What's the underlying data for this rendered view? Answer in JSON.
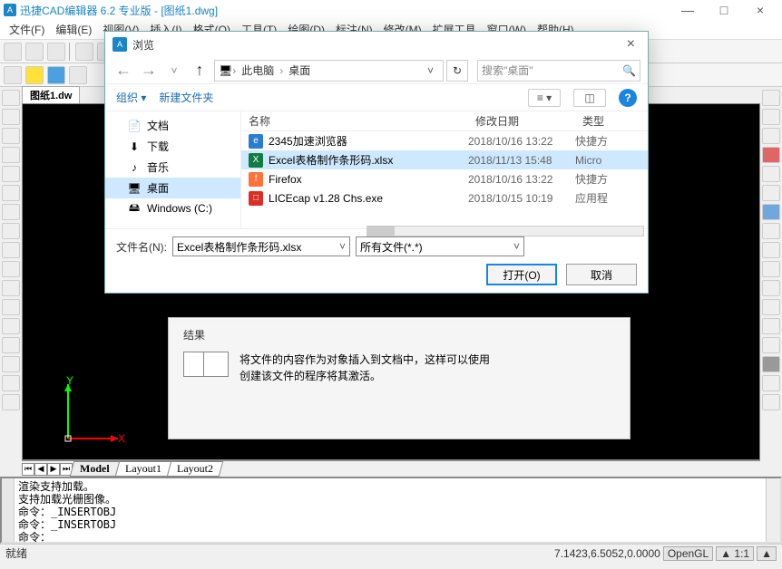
{
  "app": {
    "title": "迅捷CAD编辑器 6.2 专业版  - [图纸1.dwg]",
    "win_min": "—",
    "win_max": "□",
    "win_close": "×"
  },
  "menubar": [
    "文件(F)",
    "编辑(E)",
    "视图(V)",
    "插入(I)",
    "格式(O)",
    "工具(T)",
    "绘图(D)",
    "标注(N)",
    "修改(M)",
    "扩展工具",
    "窗口(W)",
    "帮助(H)"
  ],
  "doc_tab": "图纸1.dw",
  "layout_tabs": [
    "Model",
    "Layout1",
    "Layout2"
  ],
  "result": {
    "head": "结果",
    "body": "将文件的内容作为对象插入到文档中，这样可以使用创建该文件的程序将其激活。"
  },
  "cmd_text": "渲染支持加载。\n支持加载光栅图像。\n命令：_INSERTOBJ\n命令：_INSERTOBJ\n命令：",
  "status": {
    "left": "就绪",
    "coords": "7.1423,6.5052,0.0000",
    "gl": "OpenGL",
    "a1": "▲ 1:1",
    "a2": "▲"
  },
  "axes": {
    "x": "X",
    "y": "Y"
  },
  "dialog": {
    "title": "浏览",
    "breadcrumb": {
      "pc": "此电脑",
      "desk": "桌面"
    },
    "search_placeholder": "搜索\"桌面\"",
    "organize": "组织",
    "new_folder": "新建文件夹",
    "side": [
      {
        "icon": "📄",
        "label": "文档"
      },
      {
        "icon": "⬇",
        "label": "下载"
      },
      {
        "icon": "♪",
        "label": "音乐"
      },
      {
        "icon": "🖥",
        "label": "桌面",
        "selected": true
      },
      {
        "icon": "🖴",
        "label": "Windows (C:)"
      }
    ],
    "columns": {
      "name": "名称",
      "date": "修改日期",
      "type": "类型"
    },
    "rows": [
      {
        "icon_bg": "#2b7cd3",
        "icon_txt": "e",
        "name": "2345加速浏览器",
        "date": "2018/10/16 13:22",
        "type": "快捷方"
      },
      {
        "icon_bg": "#107c41",
        "icon_txt": "X",
        "name": "Excel表格制作条形码.xlsx",
        "date": "2018/11/13 15:48",
        "type": "Micro",
        "selected": true
      },
      {
        "icon_bg": "#ff7139",
        "icon_txt": "f",
        "name": "Firefox",
        "date": "2018/10/16 13:22",
        "type": "快捷方"
      },
      {
        "icon_bg": "#d93025",
        "icon_txt": "□",
        "name": "LICEcap v1.28 Chs.exe",
        "date": "2018/10/15 10:19",
        "type": "应用程"
      }
    ],
    "filename_label": "文件名(N):",
    "filename_value": "Excel表格制作条形码.xlsx",
    "filetype_value": "所有文件(*.*)",
    "open_btn": "打开(O)",
    "cancel_btn": "取消"
  }
}
